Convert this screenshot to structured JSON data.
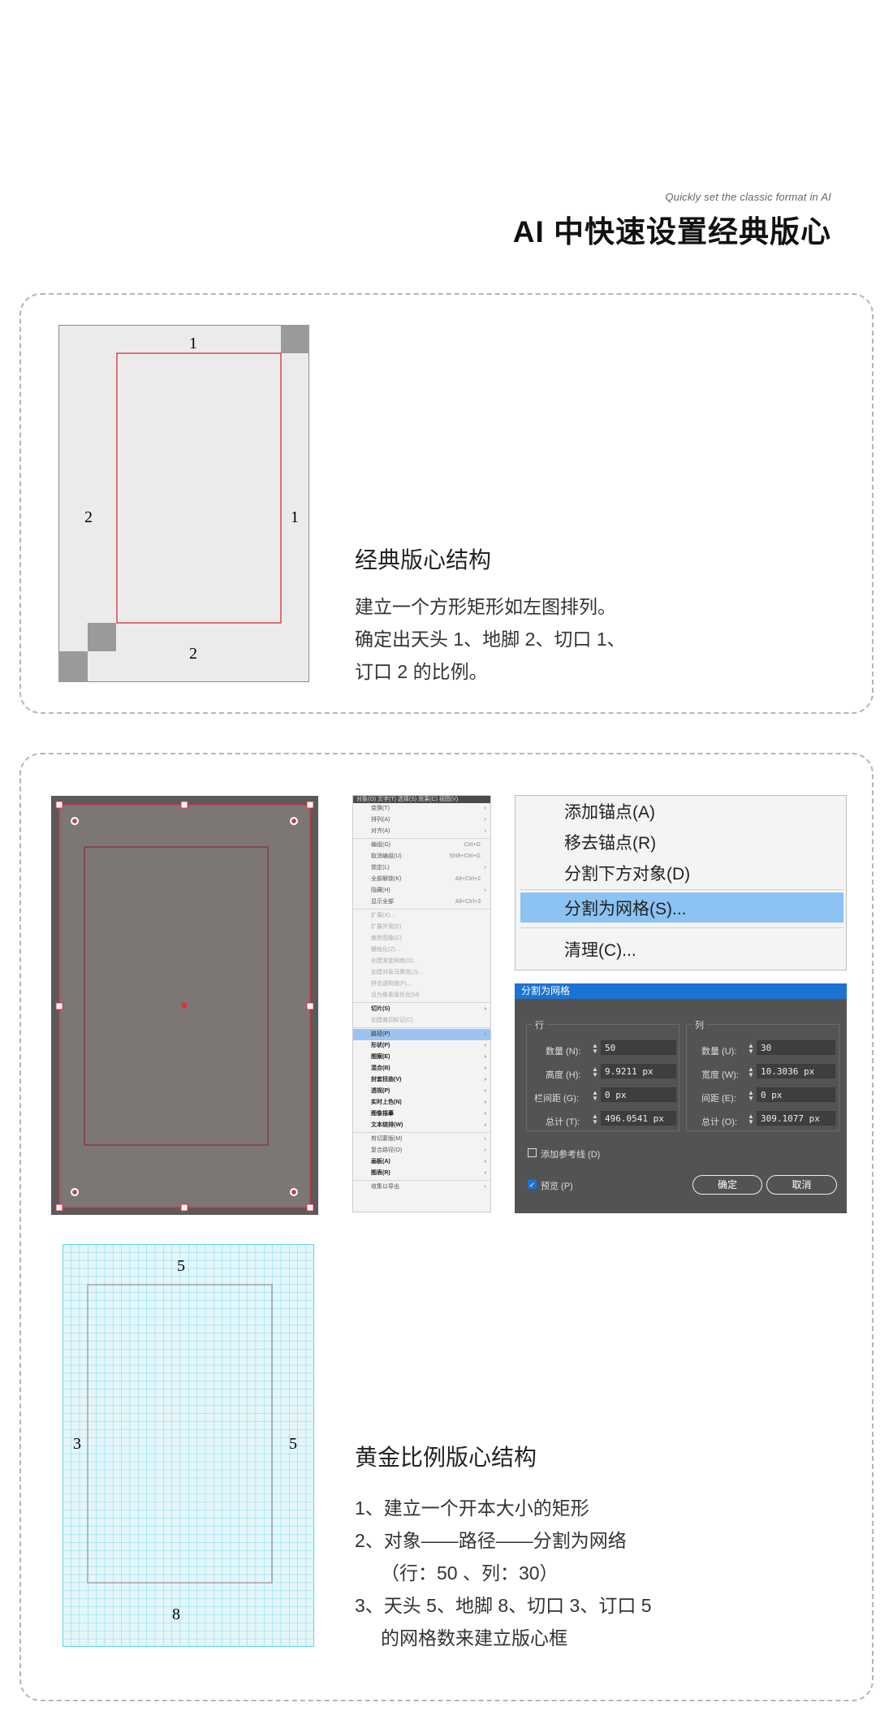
{
  "header": {
    "subtitle": "Quickly set the classic format in AI",
    "title": "AI 中快速设置经典版心"
  },
  "section1": {
    "heading": "经典版心结构",
    "lines": [
      "建立一个方形矩形如左图排列。",
      "确定出天头 1、地脚 2、切口 1、",
      "订口 2 的比例。"
    ],
    "diagram_labels": {
      "top": "1",
      "left": "2",
      "right": "1",
      "bottom": "2"
    }
  },
  "section2": {
    "menu": {
      "menubar": "对象(O)  文字(T)  选择(S)  效果(C)  视图(V)",
      "items": [
        {
          "label": "变换(T)",
          "arrow": "›",
          "style": "normal"
        },
        {
          "label": "排列(A)",
          "arrow": "›",
          "style": "normal"
        },
        {
          "label": "对齐(A)",
          "arrow": "›",
          "style": "normal"
        },
        {
          "sep": true
        },
        {
          "label": "编组(G)",
          "shortcut": "Ctrl+G",
          "style": "normal"
        },
        {
          "label": "取消编组(U)",
          "shortcut": "Shift+Ctrl+G",
          "style": "normal"
        },
        {
          "label": "锁定(L)",
          "arrow": "›",
          "style": "normal"
        },
        {
          "label": "全部解锁(K)",
          "shortcut": "Alt+Ctrl+2",
          "style": "normal"
        },
        {
          "label": "隐藏(H)",
          "arrow": "›",
          "style": "normal"
        },
        {
          "label": "显示全部",
          "shortcut": "Alt+Ctrl+3",
          "style": "normal"
        },
        {
          "sep": true
        },
        {
          "label": "扩展(X)...",
          "style": "dim"
        },
        {
          "label": "扩展外观(E)",
          "style": "dim"
        },
        {
          "label": "裁剪图像(C)",
          "style": "dim"
        },
        {
          "label": "栅格化(Z)...",
          "style": "dim"
        },
        {
          "label": "创建渐变网格(D)...",
          "style": "dim"
        },
        {
          "label": "创建对象马赛克(J)...",
          "style": "dim"
        },
        {
          "label": "拼合透明度(F)...",
          "style": "dim"
        },
        {
          "label": "设为像素级优化(M)",
          "style": "dim"
        },
        {
          "sep": true
        },
        {
          "label": "切片(S)",
          "arrow": "›",
          "style": "bold"
        },
        {
          "label": "创建裁切标记(C)",
          "style": "dim"
        },
        {
          "sep": true
        },
        {
          "label": "路径(P)",
          "arrow": "›",
          "style": "hl"
        },
        {
          "label": "形状(P)",
          "arrow": "›",
          "style": "bold"
        },
        {
          "label": "图案(E)",
          "arrow": "›",
          "style": "bold"
        },
        {
          "label": "混合(B)",
          "arrow": "›",
          "style": "bold"
        },
        {
          "label": "封套扭曲(V)",
          "arrow": "›",
          "style": "bold"
        },
        {
          "label": "透视(P)",
          "arrow": "›",
          "style": "bold"
        },
        {
          "label": "实时上色(N)",
          "arrow": "›",
          "style": "bold"
        },
        {
          "label": "图像描摹",
          "arrow": "›",
          "style": "bold"
        },
        {
          "label": "文本绕排(W)",
          "arrow": "›",
          "style": "bold"
        },
        {
          "sep": true
        },
        {
          "label": "剪切蒙版(M)",
          "arrow": "›",
          "style": "normal"
        },
        {
          "label": "复合路径(O)",
          "arrow": "›",
          "style": "normal"
        },
        {
          "label": "画板(A)",
          "arrow": "›",
          "style": "bold"
        },
        {
          "label": "图表(R)",
          "arrow": "›",
          "style": "bold"
        },
        {
          "sep": true
        },
        {
          "label": "收集以导出",
          "arrow": "›",
          "style": "normal"
        }
      ]
    },
    "context_menu": {
      "add_anchor": "添加锚点(A)",
      "remove_anchor": "移去锚点(R)",
      "divide_below": "分割下方对象(D)",
      "split_grid": "分割为网格(S)...",
      "cleanup": "清理(C)..."
    },
    "dialog": {
      "title": "分割为网格",
      "rows": {
        "group": "行",
        "number_label": "数量 (N):",
        "number": "50",
        "height_label": "高度 (H):",
        "height": "9.9211 px",
        "gutter_label": "栏间距 (G):",
        "gutter": "0 px",
        "total_label": "总计 (T):",
        "total": "496.0541 px"
      },
      "cols": {
        "group": "列",
        "number_label": "数量 (U):",
        "number": "30",
        "width_label": "宽度 (W):",
        "width": "10.3036 px",
        "gutter_label": "间距 (E):",
        "gutter": "0 px",
        "total_label": "总计 (O):",
        "total": "309.1077 px"
      },
      "add_guides": "添加参考线 (D)",
      "add_guides_checked": false,
      "preview": "预览 (P)",
      "preview_checked": true,
      "ok": "确定",
      "cancel": "取消"
    },
    "grid_labels": {
      "top": "5",
      "left": "3",
      "right": "5",
      "bottom": "8"
    },
    "heading": "黄金比例版心结构",
    "lines": [
      "1、建立一个开本大小的矩形",
      "2、对象——路径——分割为网络",
      "（行：50 、列：30）",
      "3、天头 5、地脚 8、切口 3、订口 5",
      "的网格数来建立版心框"
    ]
  },
  "colors": {
    "accent_red": "#d1323f",
    "grid_cyan": "#5fd3ec",
    "highlight_blue": "#8cc3f3",
    "dialog_title": "#1b73d3"
  }
}
